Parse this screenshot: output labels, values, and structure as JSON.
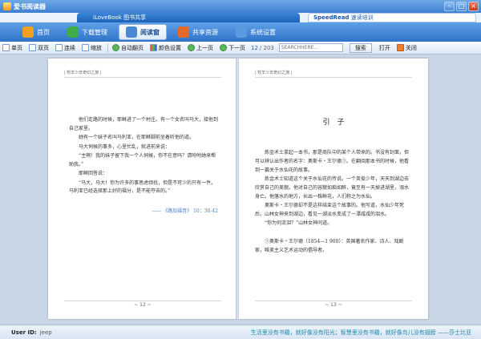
{
  "window": {
    "title": "爱书阅读器"
  },
  "banner": {
    "left_text": "iLoveBook 图书共享",
    "right_brand": "SpeedRead",
    "right_text": "速读培训"
  },
  "nav": {
    "tabs": [
      {
        "label": "首页",
        "color": "#f0a020"
      },
      {
        "label": "下载管理",
        "color": "#3fae4a"
      },
      {
        "label": "阅读窗",
        "color": "#4b88d2"
      },
      {
        "label": "共享资源",
        "color": "#e46a2a"
      },
      {
        "label": "系统设置",
        "color": "#5a9be0"
      }
    ],
    "active_index": 2
  },
  "toolbar": {
    "single_page": "单页",
    "double_page": "双页",
    "continuous": "连续",
    "zoom": "缩放",
    "auto_turn": "自动翻页",
    "color_settings": "颜色设置",
    "prev_page": "上一页",
    "next_page": "下一页",
    "current_page": "12",
    "total_pages": "/ 203",
    "search_placeholder": "SEARCHHERE...",
    "search_button": "搜索",
    "open_button": "打开",
    "close_button": "关闭"
  },
  "left_page": {
    "header": "| 牧羊少年奇幻之旅 |",
    "paragraphs": [
      "他们走路的时候，耶稣进了一个村庄。有一个女名叫马大，接他到自己家里。",
      "她有一个妹子名叫马利亚，在耶稣脚前坐着听他的道。",
      "马大伺候的事多，心里忙乱，就进前来说：",
      "“主啊！我的妹子留下我一个人伺候，你不在意吗？请吩咐她来帮助我。”",
      "耶稣回答说：",
      "“马大，马大！你为许多的事思虑烦扰，但是不可少的只有一件。马利亚已经选择那上好的福分，是不能夺去的。”"
    ],
    "citation": "—— 《路加福音》 10：38-42",
    "footer": "~ 12 ~"
  },
  "right_page": {
    "header": "| 牧羊少年奇幻之旅 |",
    "title": "引　子",
    "paragraphs": [
      "炼金术士拿起一本书，那是商队中的某个人带来的。书没有封面，但可以辨认出作者的名字：奥斯卡・王尔德①。在翻阅那本书的时候，他看到一篇关于水仙花的故事。",
      "炼金术士知道这个关于水仙花的传说。一个英俊少年，天天到湖边去欣赏自己的美貌。他对自己的容貌如痴如醉，竟至有一天掉进湖里，溺水身亡。他落水的地方，长出一株鲜花，人们称之为水仙。",
      "奥斯卡・王尔德却不是这样结束这个故事的。他写道，水仙少年死后，山林女神来到湖边，看见一湖淡水变成了一潭咸咸的泪水。",
      "“你为何流泪？”山林女神问道。"
    ],
    "note": "①奥斯卡・王尔德（1854—1 900）：英国著名作家、诗人、戏剧家，唯美主义艺术运动的倡导者。",
    "footer": "~ 13 ~"
  },
  "status": {
    "label": "User ID:",
    "user_id": "jeep",
    "motto": "生活里没有书籍，就好像没有阳光；智慧里没有书籍，就好像鸟儿没有翅膀 ——莎士比亚"
  }
}
